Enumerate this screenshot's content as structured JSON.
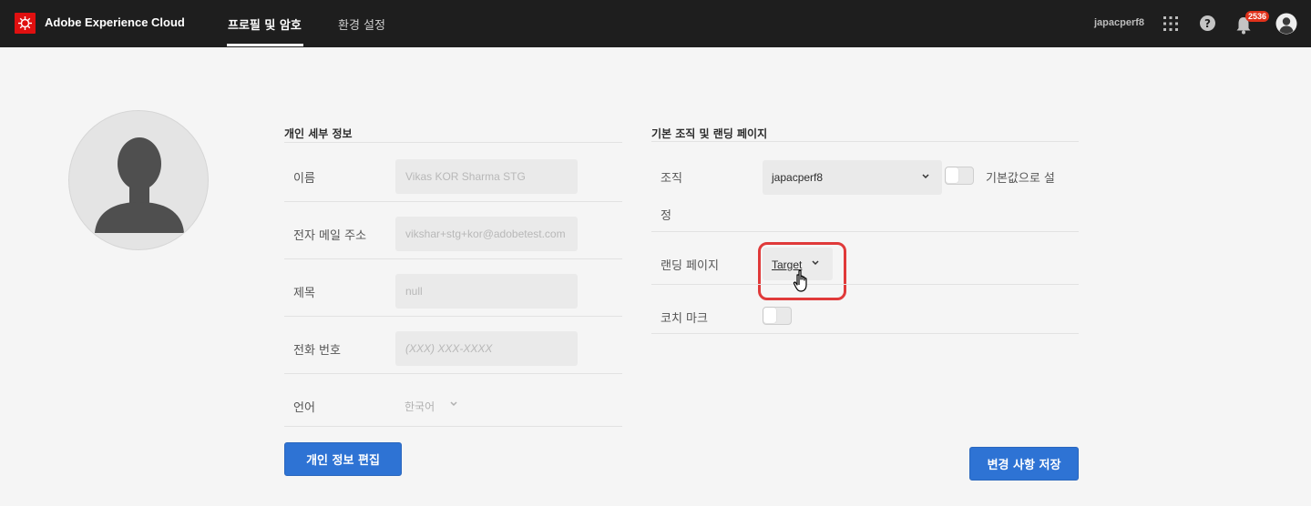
{
  "header": {
    "brand": "Adobe Experience Cloud",
    "tabs": [
      {
        "label": "프로필 및 암호",
        "active": true
      },
      {
        "label": "환경 설정",
        "active": false
      }
    ],
    "org_name": "japacperf8",
    "notification_count": "2536",
    "icons": [
      "adobe-logo-icon",
      "apps-grid-icon",
      "help-icon",
      "bell-icon",
      "user-icon"
    ]
  },
  "personal": {
    "title": "개인 세부 정보",
    "rows": [
      {
        "label": "이름",
        "value": "Vikas KOR Sharma STG"
      },
      {
        "label": "전자 메일 주소",
        "value": "vikshar+stg+kor@adobetest.com"
      },
      {
        "label": "제목",
        "value": "null"
      },
      {
        "label": "전화 번호",
        "placeholder": "(XXX) XXX-XXXX"
      },
      {
        "label": "언어",
        "value": "한국어"
      }
    ],
    "edit_button": "개인 정보 편집"
  },
  "org": {
    "title": "기본 조직 및 랜딩 페이지",
    "org_label": "조직",
    "org_value": "japacperf8",
    "default_label_line1": "기본값으로 설",
    "default_label_line2": "정",
    "default_toggle_on": false,
    "landing_label": "랜딩 페이지",
    "landing_value": "Target",
    "coach_label": "코치 마크",
    "coach_toggle_on": false,
    "save_button": "변경 사항 저장"
  },
  "colors": {
    "topbar": "#1e1e1e",
    "accent": "#2e73d4",
    "badge": "#e0311b",
    "highlight": "#e03a3a"
  }
}
